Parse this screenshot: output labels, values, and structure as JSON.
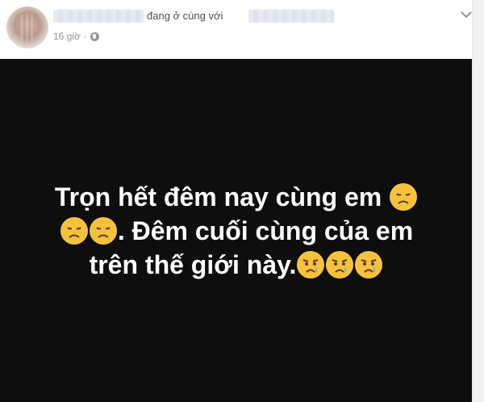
{
  "header": {
    "status": "đang ở cùng với",
    "time": "16 giờ",
    "privacy_icon": "globe-icon",
    "menu_icon": "chevron-down-icon"
  },
  "post": {
    "line1": "Trọn hết đêm nay cùng em",
    "line2": ". Đêm cuối cùng của em",
    "line3": "trên thế giới này.",
    "emoji_sad": "disappointed-face",
    "emoji_cry": "sad-but-relieved-face"
  }
}
